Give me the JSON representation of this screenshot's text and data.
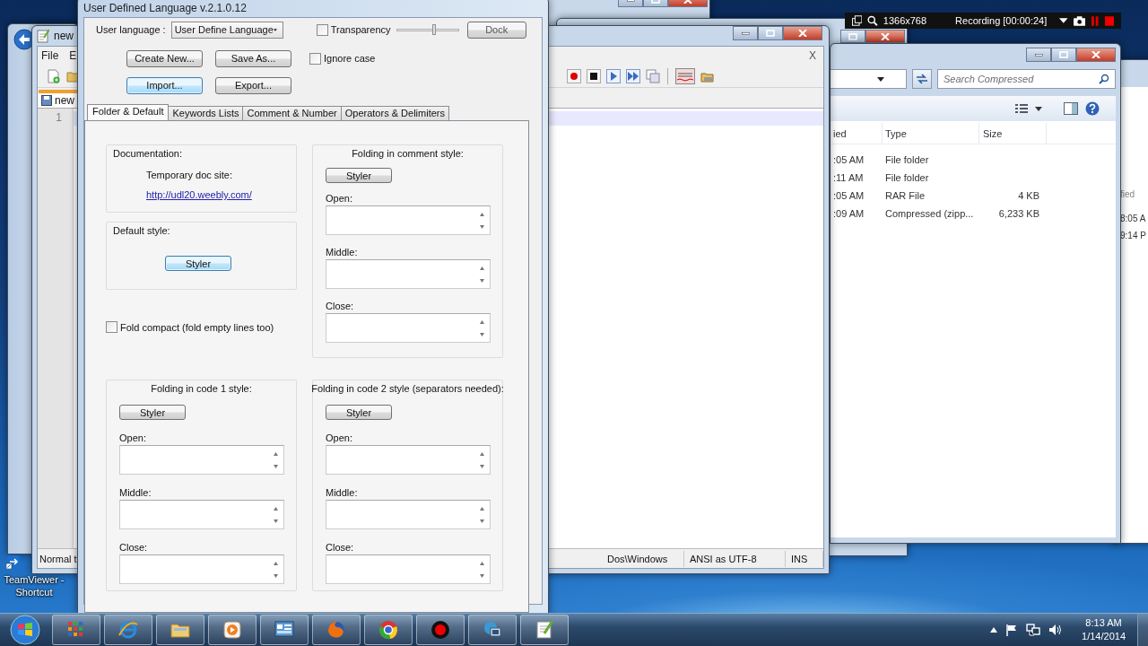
{
  "udl_dialog": {
    "title": "User Defined Language v.2.1.0.12",
    "language_label": "User language :",
    "language_value": "User Define Language",
    "transparency": {
      "label": "Transparency",
      "checked": false
    },
    "transparency_slider": {
      "level": 0.6
    },
    "dock_button": "Dock",
    "ignore_case": {
      "label": "Ignore case",
      "checked": false
    },
    "buttons": [
      {
        "label": "Create New...",
        "focused": false
      },
      {
        "label": "Save As...",
        "focused": false
      },
      {
        "label": "Import...",
        "focused": true
      },
      {
        "label": "Export...",
        "focused": false
      }
    ],
    "tabs": [
      {
        "label": "Folder & Default",
        "selected": true
      },
      {
        "label": "Keywords Lists",
        "selected": false
      },
      {
        "label": "Comment & Number",
        "selected": false
      },
      {
        "label": "Operators & Delimiters",
        "selected": false
      }
    ],
    "documentation": {
      "heading": "Documentation:",
      "site_label": "Temporary doc site:",
      "link": "http://udl20.weebly.com/"
    },
    "default_style": {
      "heading": "Default style:",
      "styler": {
        "label": "Styler",
        "focused": true
      }
    },
    "fold_compact": {
      "label": "Fold compact (fold empty lines too)",
      "checked": false
    },
    "folding_groups": [
      {
        "heading": "Folding in comment style:",
        "styler": {
          "label": "Styler",
          "focused": false
        },
        "fields": [
          "Open:",
          "Middle:",
          "Close:"
        ]
      },
      {
        "heading": "Folding in code 1 style:",
        "styler": {
          "label": "Styler",
          "focused": false
        },
        "fields": [
          "Open:",
          "Middle:",
          "Close:"
        ]
      },
      {
        "heading": "Folding in code 2 style (separators needed):",
        "styler": {
          "label": "Styler",
          "focused": false
        },
        "fields": [
          "Open:",
          "Middle:",
          "Close:"
        ]
      }
    ]
  },
  "editor": {
    "title": "new",
    "menu": [
      "File",
      "E"
    ],
    "close_doc": "X",
    "tab": "new",
    "line_number": "1",
    "status": [
      "Normal t",
      "Dos\\Windows",
      "ANSI as UTF-8",
      "INS"
    ]
  },
  "explorer": {
    "search_placeholder": "Search Compressed",
    "columns": [
      "ied",
      "Type",
      "Size"
    ],
    "rows": [
      {
        "modified": ":05 AM",
        "type": "File folder"
      },
      {
        "modified": ":11 AM",
        "type": "File folder"
      },
      {
        "modified": ":05 AM",
        "type": "RAR File",
        "size": "4 KB"
      },
      {
        "modified": ":09 AM",
        "type": "Compressed (zipp...",
        "size": "6,233 KB"
      }
    ]
  },
  "side_window": {
    "texts": [
      "fied",
      "8:05 A",
      "9:14 P"
    ]
  },
  "recorder": {
    "resolution": "1366x768",
    "status": "Recording [00:00:24]"
  },
  "desktop_icons": [
    {
      "label": "TeamViewer - Shortcut"
    }
  ],
  "taskbar": {
    "time": "8:13 AM",
    "date": "1/14/2014"
  }
}
